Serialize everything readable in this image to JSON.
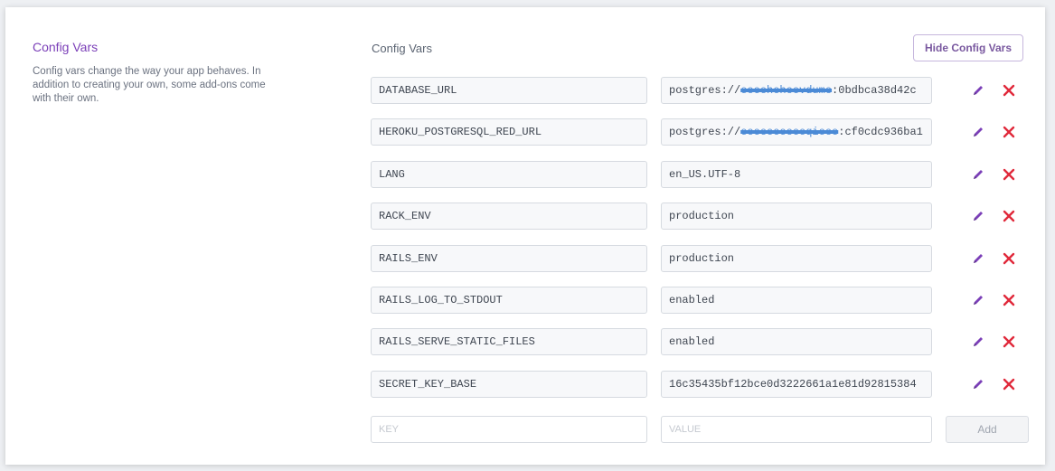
{
  "section": {
    "title": "Config Vars",
    "description": "Config vars change the way your app behaves. In addition to creating your own, some add-ons come with their own."
  },
  "panel": {
    "title": "Config Vars",
    "hide_button_label": "Hide Config Vars"
  },
  "vars": [
    {
      "key": "DATABASE_URL",
      "value_prefix": "postgres://",
      "value_masked": "eeeeheheevdume",
      "value_suffix": ":0bdbca38d42c"
    },
    {
      "key": "HEROKU_POSTGRESQL_RED_URL",
      "value_prefix": "postgres://",
      "value_masked": "eeeeeeeeeeqieee",
      "value_suffix": ":cf0cdc936ba1"
    },
    {
      "key": "LANG",
      "value_prefix": "en_US.UTF-8",
      "value_masked": "",
      "value_suffix": ""
    },
    {
      "key": "RACK_ENV",
      "value_prefix": "production",
      "value_masked": "",
      "value_suffix": ""
    },
    {
      "key": "RAILS_ENV",
      "value_prefix": "production",
      "value_masked": "",
      "value_suffix": ""
    },
    {
      "key": "RAILS_LOG_TO_STDOUT",
      "value_prefix": "enabled",
      "value_masked": "",
      "value_suffix": ""
    },
    {
      "key": "RAILS_SERVE_STATIC_FILES",
      "value_prefix": "enabled",
      "value_masked": "",
      "value_suffix": ""
    },
    {
      "key": "SECRET_KEY_BASE",
      "value_prefix": "16c35435bf12bce0d3222661a1e81d92815384",
      "value_masked": "",
      "value_suffix": ""
    }
  ],
  "new_var": {
    "key_placeholder": "KEY",
    "value_placeholder": "VALUE",
    "add_label": "Add"
  },
  "icons": {
    "edit": "pencil-icon",
    "delete": "close-icon"
  },
  "colors": {
    "accent": "#79589f",
    "edit_icon": "#7b3fb8",
    "delete_icon": "#e0283a"
  }
}
